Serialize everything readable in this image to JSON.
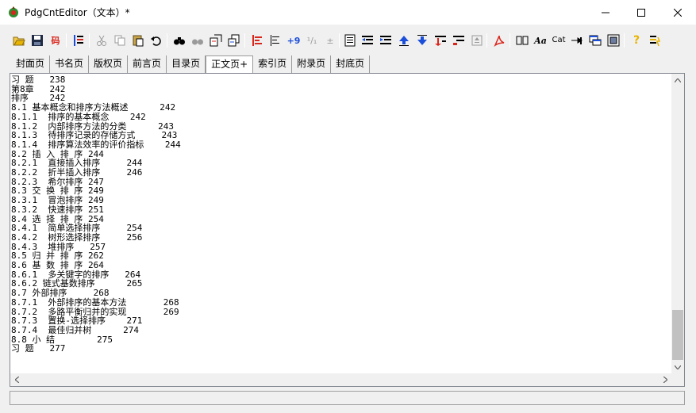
{
  "window": {
    "title": "PdgCntEditor（文本）*",
    "controls": {
      "minimize": "minimize-icon",
      "maximize": "maximize-icon",
      "close": "close-icon"
    }
  },
  "toolbar": {
    "buttons": [
      "open-folder-icon",
      "save-icon",
      "encoding-icon",
      "bookmark-tree-icon",
      "cut-icon",
      "copy-icon",
      "paste-icon",
      "undo-icon",
      "find-icon",
      "find-replace-icon",
      "find-page-icon",
      "find-next-page-icon",
      "align-left-icon",
      "align-list-icon",
      "page-number-icon",
      "page-number-align-icon",
      "plus-minus-icon",
      "page-icon",
      "outdent-icon",
      "indent-icon",
      "move-up-icon",
      "move-down-icon",
      "level-down-icon",
      "level-up-icon",
      "collapse-icon",
      "pdf-icon",
      "columns-icon",
      "font-icon",
      "catalog-icon",
      "link-icon",
      "window-icon",
      "export-icon",
      "help-icon",
      "about-icon"
    ],
    "text_buttons": {
      "encoding": "码",
      "font": "Aa",
      "catalog": "Cat"
    }
  },
  "tabs": [
    "封面页",
    "书名页",
    "版权页",
    "前言页",
    "目录页",
    "正文页+",
    "索引页",
    "附录页",
    "封底页"
  ],
  "active_tab": "正文页+",
  "content_lines": [
    "习 题   238",
    "第8章   242",
    "排序    242",
    "8.1 基本概念和排序方法概述      242",
    "8.1.1  排序的基本概念    242",
    "8.1.2  内部排序方法的分类      243",
    "8.1.3  待排序记录的存储方式     243",
    "8.1.4  排序算法效率的评价指标    244",
    "8.2 插 入 排 序 244",
    "8.2.1  直接插入排序     244",
    "8.2.2  折半插入排序     246",
    "8.2.3  希尔排序 247",
    "8.3 交 换 排 序 249",
    "8.3.1  冒泡排序 249",
    "8.3.2  快速排序 251",
    "8.4 选 择 排 序 254",
    "8.4.1  简单选择排序     254",
    "8.4.2  树形选择排序     256",
    "8.4.3  堆排序   257",
    "8.5 归 并 排 序 262",
    "8.6 基 数 排 序 264",
    "8.6.1  多关键字的排序   264",
    "8.6.2 链式基数排序      265",
    "8.7 外部排序     268",
    "8.7.1  外部排序的基本方法       268",
    "8.7.2  多路平衡归并的实现       269",
    "8.7.3  置换-选择排序    271",
    "8.7.4  最佳归并树      274",
    "8.8 小 结        275",
    "习 题   277"
  ],
  "colors": {
    "accent_red": "#d9261c",
    "accent_blue": "#1c4fd9",
    "accent_yellow": "#e8b400",
    "window_bg": "#f0f0f0"
  }
}
